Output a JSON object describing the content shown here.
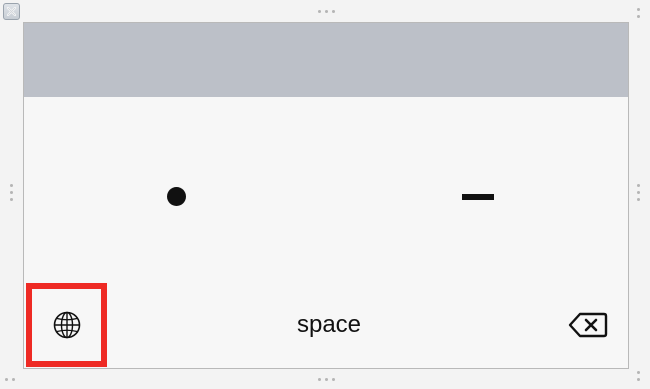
{
  "window": {
    "close_icon": "close-icon"
  },
  "keyboard": {
    "keys": {
      "dot": {
        "icon": "dot-icon"
      },
      "dash": {
        "icon": "dash-icon"
      },
      "globe": {
        "icon": "globe-icon"
      },
      "space_label": "space",
      "delete": {
        "icon": "delete-backspace-icon"
      }
    },
    "top_bar_color": "#bcc0c8"
  },
  "highlight": {
    "target": "globe-key",
    "color": "#ee2a24"
  }
}
